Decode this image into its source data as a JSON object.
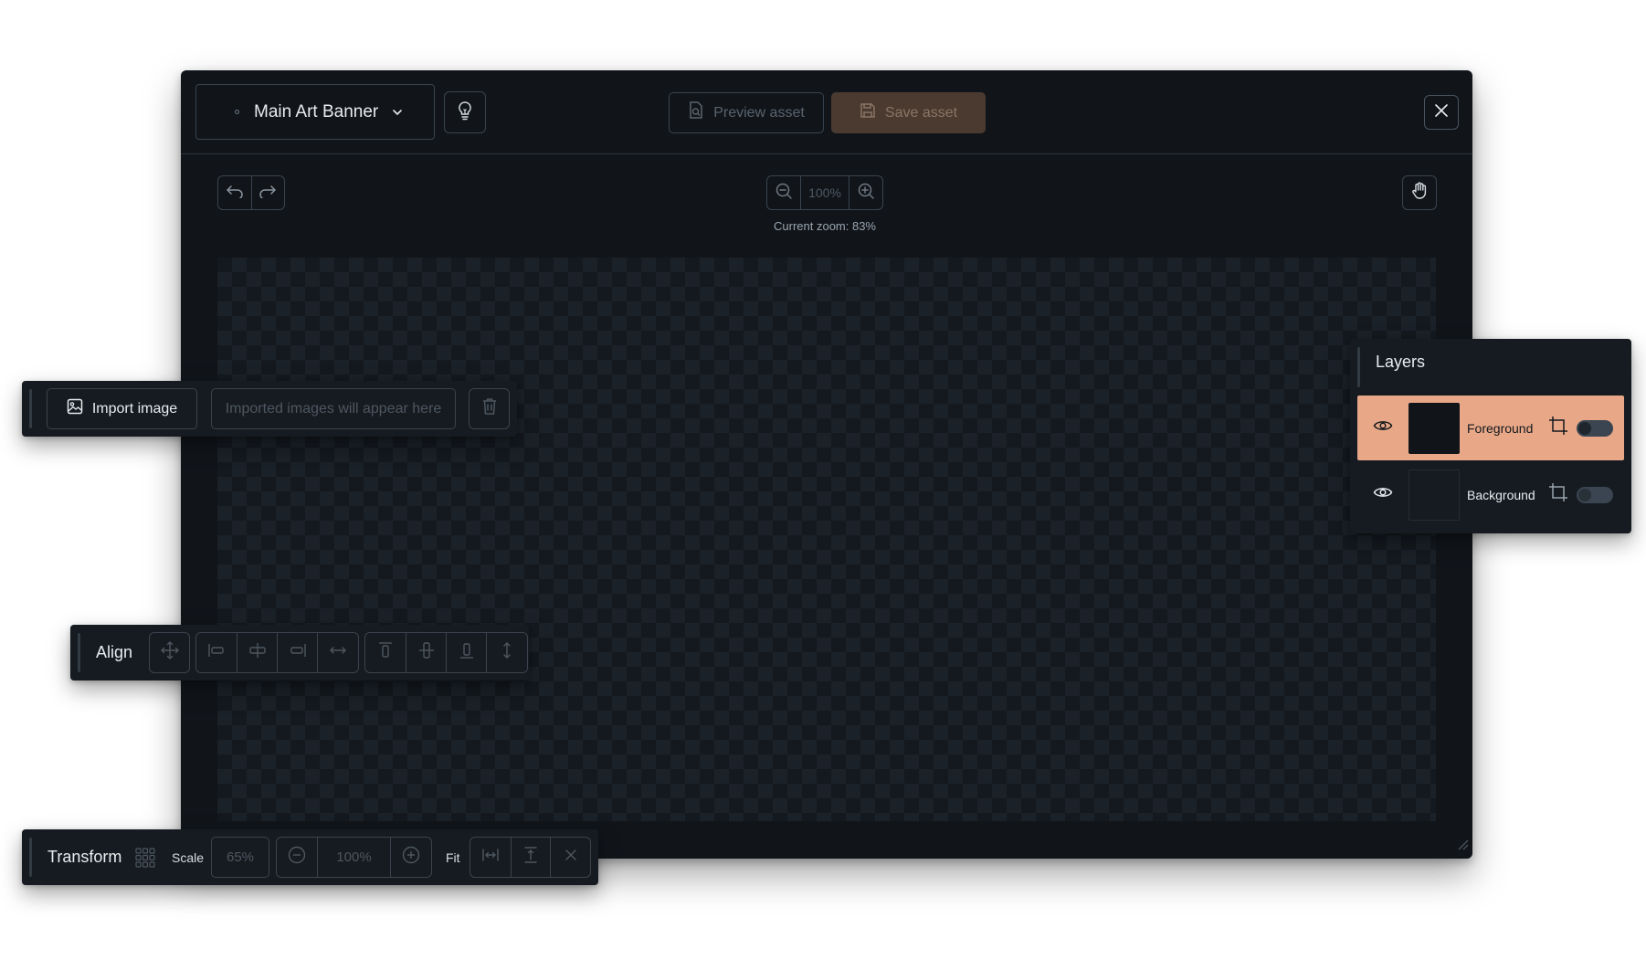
{
  "header": {
    "asset_name": "Main Art Banner",
    "preview_label": "Preview asset",
    "save_label": "Save asset"
  },
  "toolbar": {
    "zoom_value": "100%",
    "zoom_caption": "Current zoom: 83%"
  },
  "import": {
    "button_label": "Import image",
    "placeholder": "Imported images will appear here"
  },
  "align": {
    "title": "Align"
  },
  "transform": {
    "title": "Transform",
    "scale_label": "Scale",
    "scale_value": "65%",
    "scale_step_value": "100%",
    "fit_label": "Fit"
  },
  "layers": {
    "title": "Layers",
    "items": [
      {
        "name": "Foreground",
        "active": true,
        "visible_toggle": false
      },
      {
        "name": "Background",
        "active": false,
        "visible_toggle": false
      }
    ]
  },
  "colors": {
    "accent": "#e8a888",
    "editor_bg": "#11151a",
    "save_button_bg": "#4a3a30"
  },
  "icons": {
    "hint": "lightbulb-icon",
    "preview": "file-search-icon",
    "save": "floppy-disk-icon",
    "close": "close-icon",
    "undo": "undo-icon",
    "redo": "redo-icon",
    "zoom_out": "zoom-out-icon",
    "zoom_in": "zoom-in-icon",
    "pan": "hand-icon",
    "import": "image-icon",
    "delete": "trash-icon",
    "eye": "eye-icon",
    "crop": "crop-icon"
  }
}
